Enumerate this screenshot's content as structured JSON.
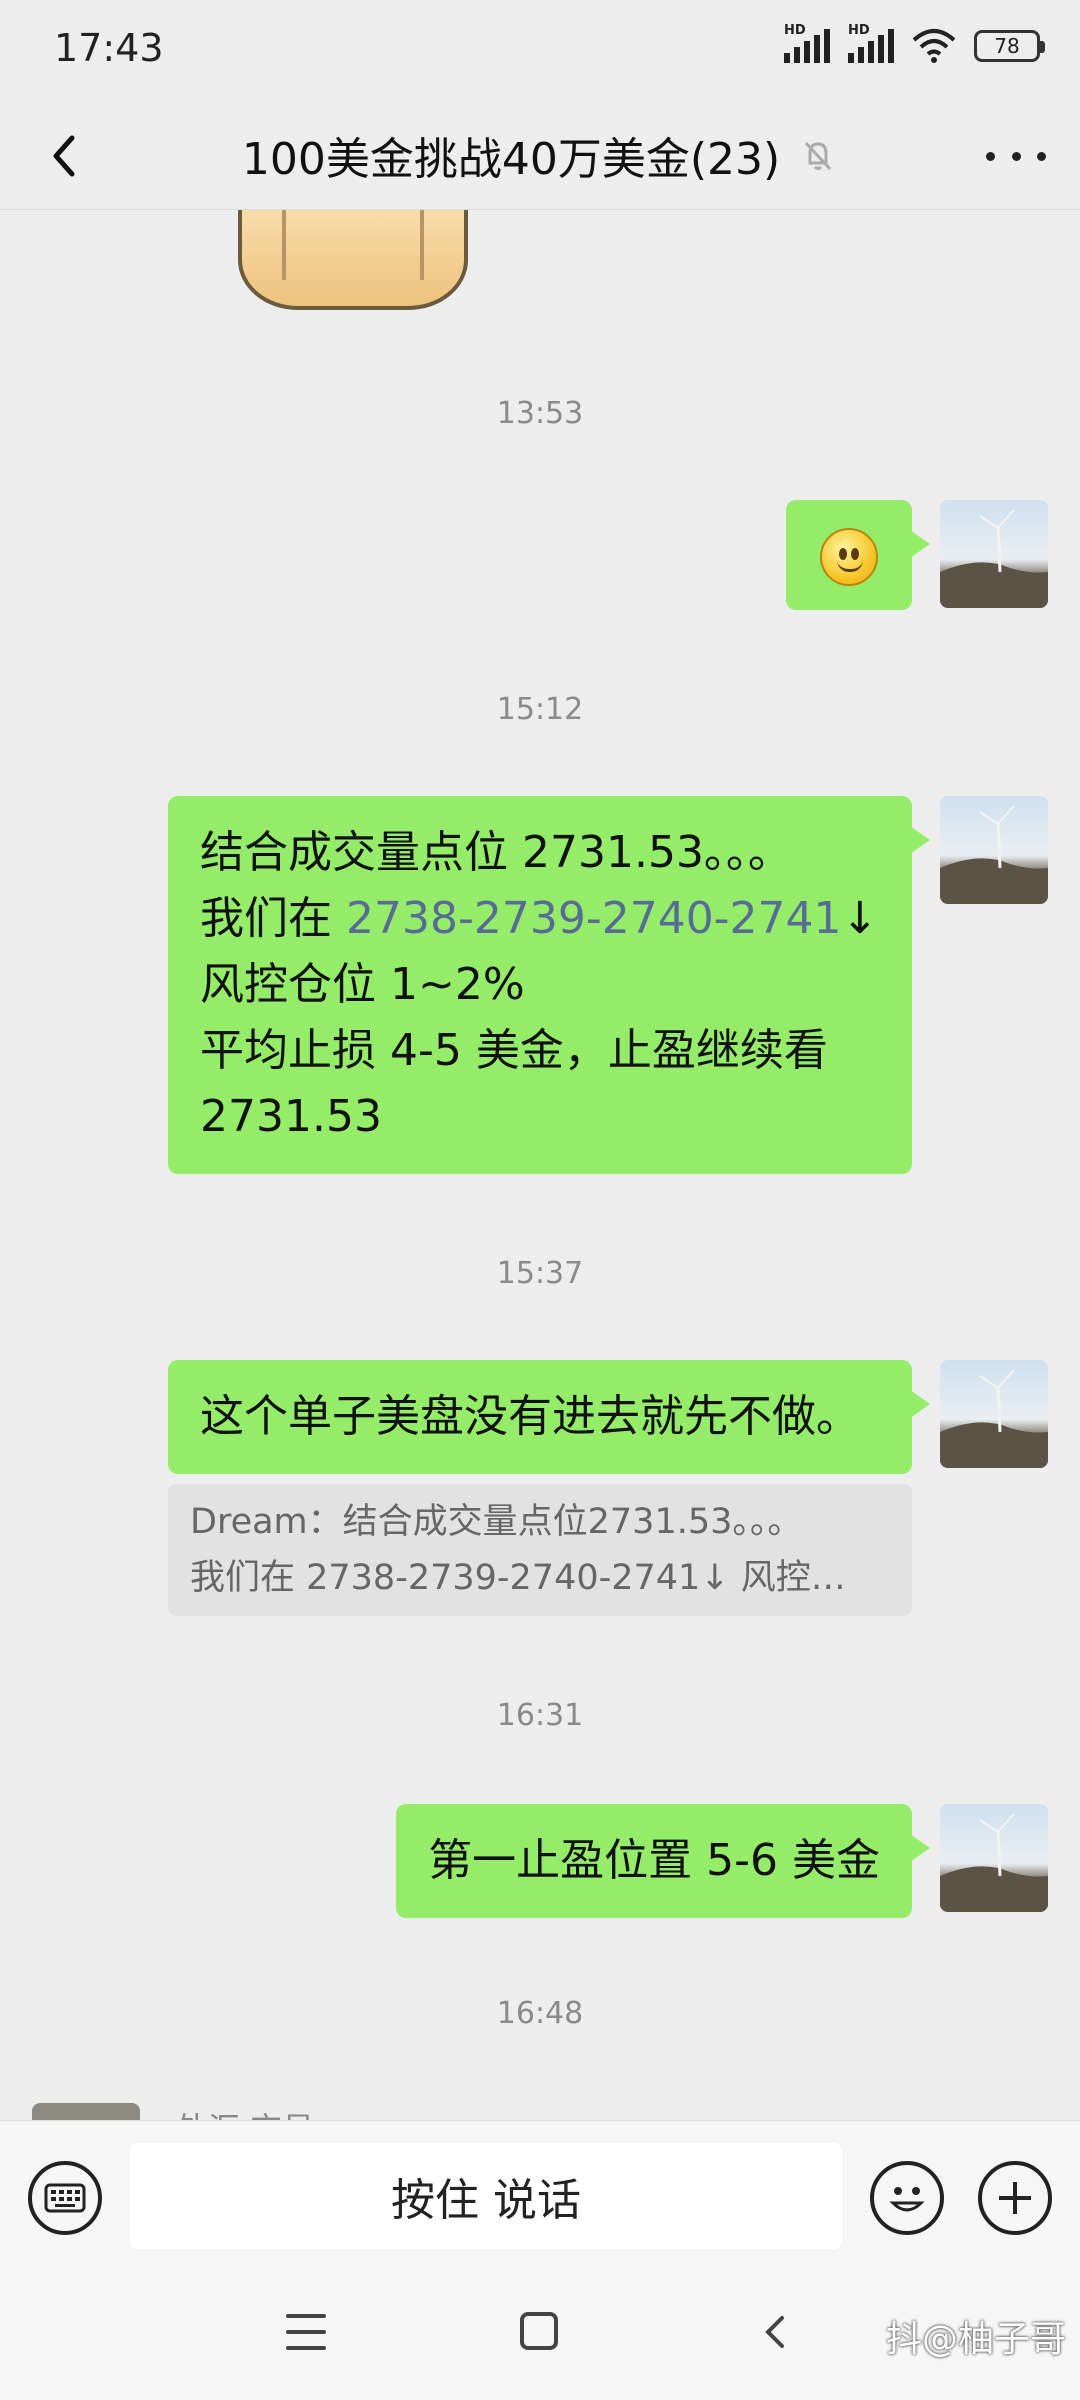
{
  "status": {
    "time": "17:43",
    "network_1": "HD",
    "network_2": "HD",
    "battery": "78"
  },
  "header": {
    "title": "100美金挑战40万美金(23)",
    "icons": [
      "back-arrow-icon",
      "mute-bell-icon",
      "more-icon"
    ]
  },
  "messages": [
    {
      "type": "sticker",
      "name": "sticker-partial"
    },
    {
      "type": "timestamp",
      "text": "13:53"
    },
    {
      "type": "emoji",
      "icon": "smile-emoji-icon"
    },
    {
      "type": "timestamp",
      "text": "15:12"
    },
    {
      "type": "text",
      "lines": {
        "l1": "结合成交量点位 2731.53。。。",
        "l2_prefix": "我们在 ",
        "l2_link": "2738-2739-2740-2741",
        "l2_suffix": "↓",
        "l3": "风控仓位 1~2%",
        "l4": "平均止损 4-5 美金，止盈继续看",
        "l5": "2731.53"
      }
    },
    {
      "type": "timestamp",
      "text": "15:37"
    },
    {
      "type": "text",
      "text": "这个单子美盘没有进去就先不做。"
    },
    {
      "type": "quote",
      "line1": "Dream：结合成交量点位2731.53。。。",
      "line2": "我们在 2738-2739-2740-2741↓   风控…"
    },
    {
      "type": "timestamp",
      "text": "16:31"
    },
    {
      "type": "text",
      "text": "第一止盈位置 5-6 美金"
    },
    {
      "type": "timestamp",
      "text": "16:48"
    },
    {
      "type": "incoming_partial",
      "name": "外汇 交易"
    }
  ],
  "input_bar": {
    "hold_to_talk": "按住 说话"
  },
  "nav": {
    "watermark": "抖@柚子哥"
  },
  "colors": {
    "background": "#ededed",
    "bubble_green": "#95ec69",
    "link_blue": "#576b95",
    "timestamp_gray": "#8a8a8a"
  }
}
